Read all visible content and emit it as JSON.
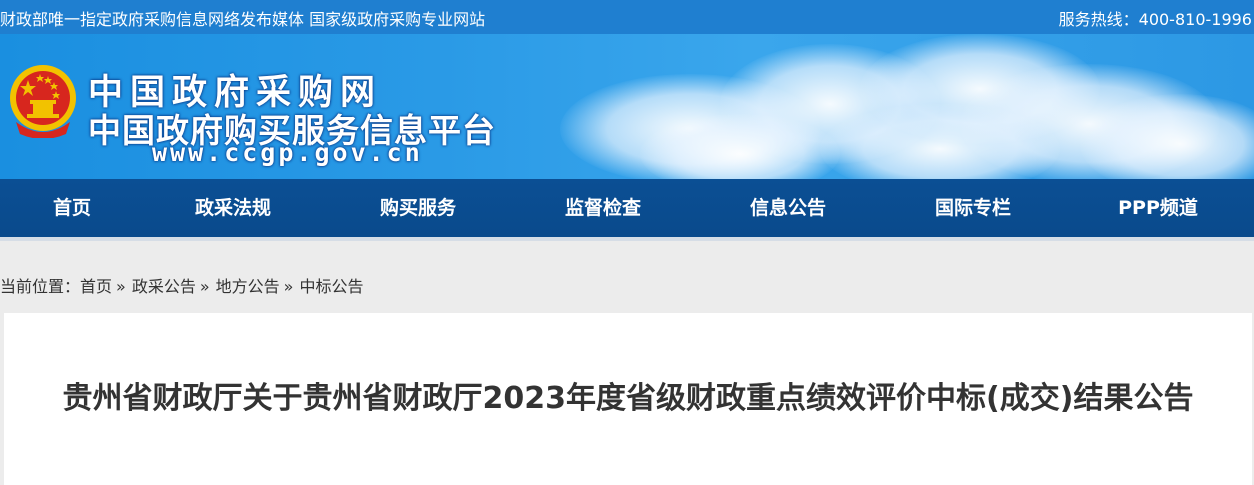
{
  "topbar": {
    "slogan": "财政部唯一指定政府采购信息网络发布媒体 国家级政府采购专业网站",
    "hotline": "服务热线：400-810-1996"
  },
  "header": {
    "title": "中国政府采购网",
    "subtitle": "中国政府购买服务信息平台",
    "url": "www.ccgp.gov.cn"
  },
  "nav": {
    "items": [
      "首页",
      "政采法规",
      "购买服务",
      "监督检查",
      "信息公告",
      "国际专栏",
      "PPP频道"
    ]
  },
  "breadcrumb": {
    "prefix": "当前位置：",
    "items": [
      "首页",
      "政采公告",
      "地方公告",
      "中标公告"
    ],
    "separator": "»"
  },
  "article": {
    "title": "贵州省财政厅关于贵州省财政厅2023年度省级财政重点绩效评价中标(成交)结果公告"
  },
  "colors": {
    "topbar": "#1f7fd0",
    "nav": "#0b4f94",
    "emblem_red": "#d7261e",
    "emblem_gold": "#f2c200"
  }
}
